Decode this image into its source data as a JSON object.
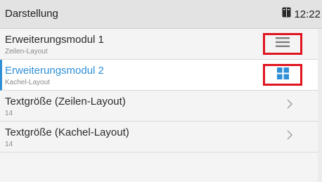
{
  "header": {
    "title": "Darstellung",
    "time": "12:22"
  },
  "items": [
    {
      "label": "Erweiterungsmodul 1",
      "sub": "Zeilen-Layout",
      "icon": "list-lines-icon"
    },
    {
      "label": "Erweiterungsmodul 2",
      "sub": "Kachel-Layout",
      "icon": "tiles-grid-icon"
    },
    {
      "label": "Textgröße (Zeilen-Layout)",
      "sub": "14",
      "icon": "chevron-right-icon"
    },
    {
      "label": "Textgröße (Kachel-Layout)",
      "sub": "14",
      "icon": "chevron-right-icon"
    }
  ],
  "colors": {
    "accent": "#2f8fd6",
    "highlight_box": "#e0141e"
  }
}
